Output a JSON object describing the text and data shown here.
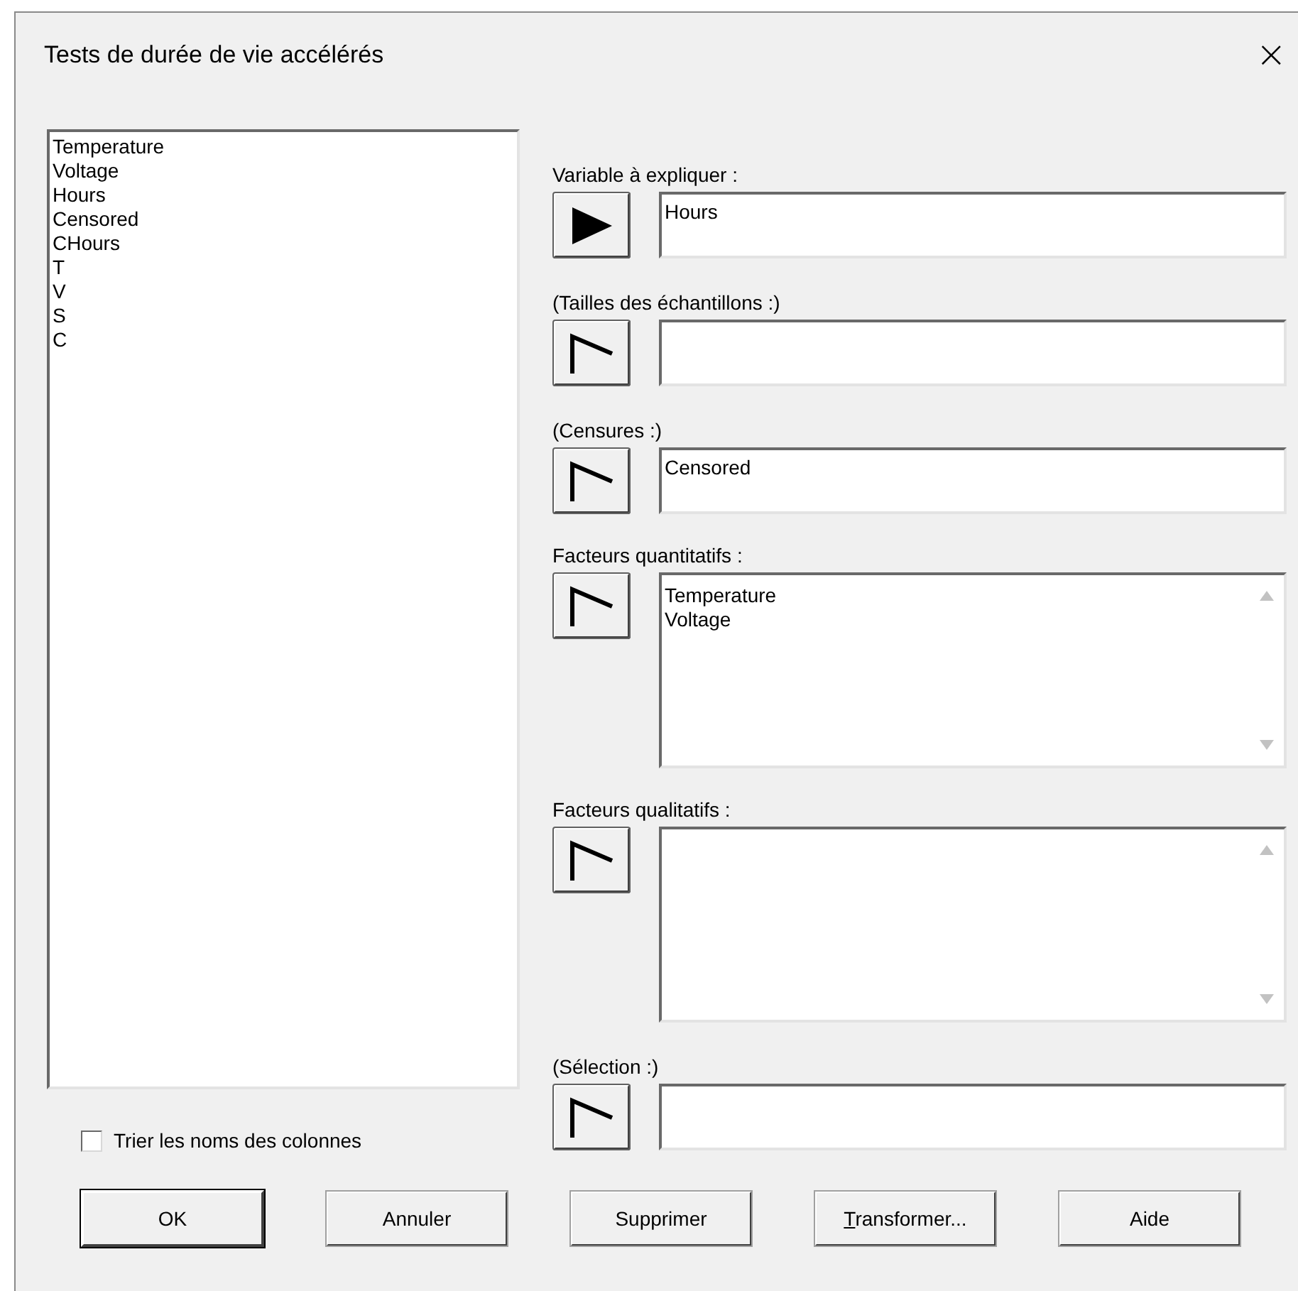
{
  "window": {
    "title": "Tests de durée de vie accélérés",
    "close": "×"
  },
  "columns": [
    "Temperature",
    "Voltage",
    "Hours",
    "Censored",
    "CHours",
    "T",
    "V",
    "S",
    "C"
  ],
  "sort_option": {
    "label": "Trier les noms des colonnes",
    "checked": false
  },
  "slots": [
    {
      "label": "Variable à expliquer :",
      "kind": "field",
      "filled_arrow": true,
      "values": [
        "Hours"
      ]
    },
    {
      "label": "(Tailles des échantillons :)",
      "kind": "field",
      "filled_arrow": false
    },
    {
      "label": "(Censures :)",
      "kind": "field",
      "filled_arrow": false,
      "values": [
        "Censored"
      ]
    },
    {
      "label": "Facteurs quantitatifs :",
      "kind": "list",
      "filled_arrow": false,
      "values": [
        "Temperature",
        "Voltage"
      ]
    },
    {
      "label": "Facteurs qualitatifs :",
      "kind": "list",
      "filled_arrow": false
    },
    {
      "label": "(Sélection :)",
      "kind": "field",
      "filled_arrow": false
    }
  ],
  "buttons": [
    {
      "label": "OK",
      "default": true,
      "accelerator": false
    },
    {
      "label": "Annuler",
      "default": false,
      "accelerator": false
    },
    {
      "label": "Supprimer",
      "default": false,
      "accelerator": false
    },
    {
      "label": "Transformer...",
      "default": false,
      "accelerator": true
    },
    {
      "label": "Aide",
      "default": false,
      "accelerator": false
    }
  ]
}
